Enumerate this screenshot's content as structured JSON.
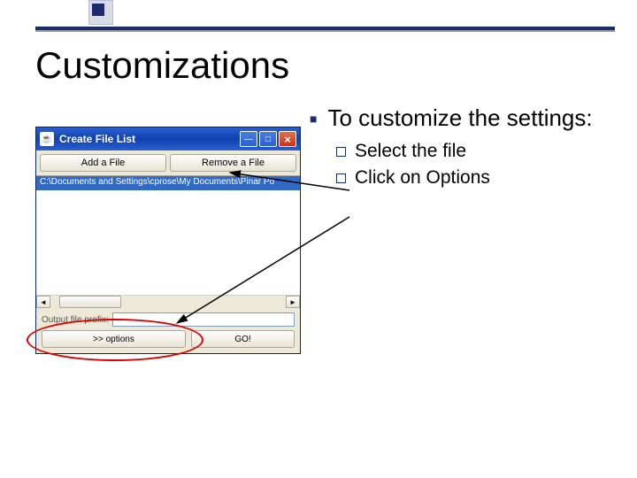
{
  "slide": {
    "title": "Customizations"
  },
  "window": {
    "title": "Create File List",
    "toolbar": {
      "add": "Add a File",
      "remove": "Remove a File"
    },
    "file_path": "C:\\Documents and Settings\\cprose\\My Documents\\Pinar Po",
    "prefix_label": "Output file prefix:",
    "options_btn": ">> options",
    "go_btn": "GO!"
  },
  "text": {
    "main": "To customize the settings:",
    "sub1": "Select the file",
    "sub2": "Click on Options"
  }
}
